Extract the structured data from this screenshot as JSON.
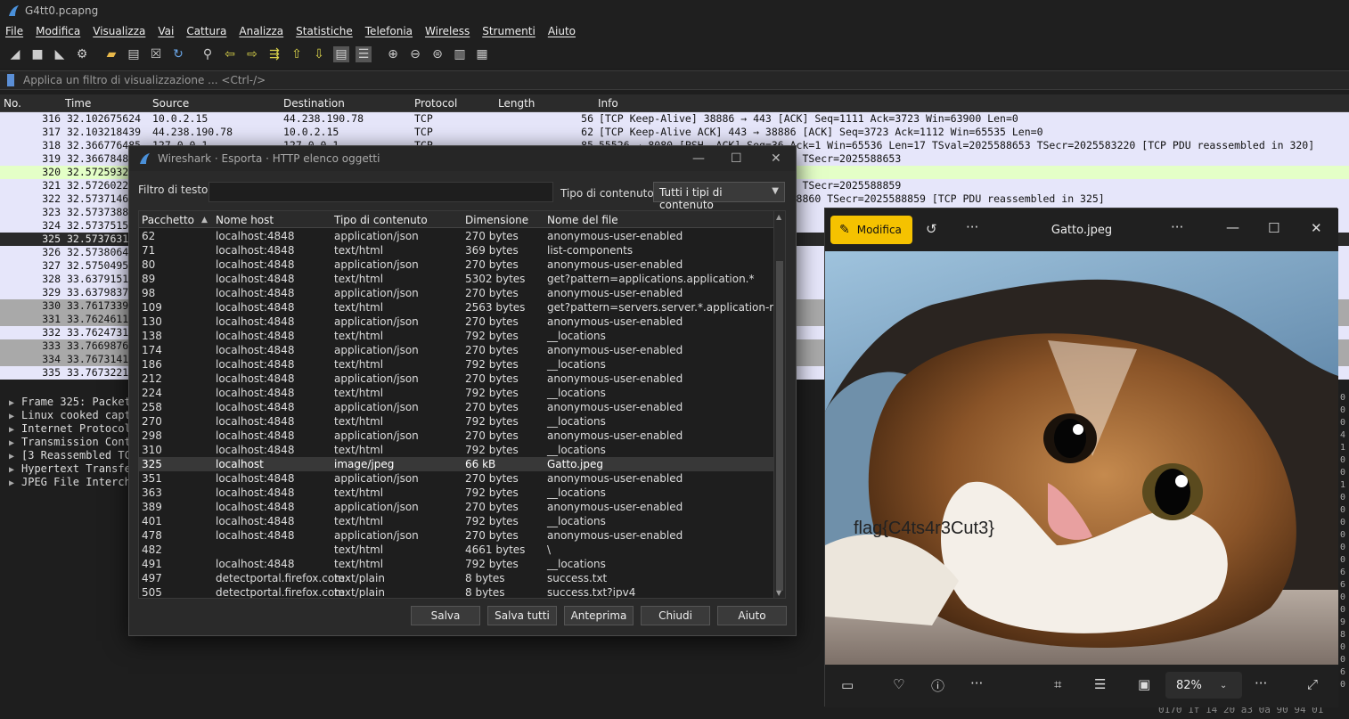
{
  "window": {
    "title": "G4tt0.pcapng"
  },
  "menu": [
    "File",
    "Modifica",
    "Visualizza",
    "Vai",
    "Cattura",
    "Analizza",
    "Statistiche",
    "Telefonia",
    "Wireless",
    "Strumenti",
    "Aiuto"
  ],
  "toolbar_icons": [
    "shark-fin-start-icon",
    "stop-icon",
    "restart-icon",
    "options-gear-icon",
    "open-folder-icon",
    "open-file-icon",
    "close-file-icon",
    "reload-icon",
    "find-icon",
    "back-arrow-icon",
    "forward-arrow-icon",
    "goto-packet-icon",
    "first-packet-icon",
    "last-packet-icon",
    "autoscroll-icon",
    "colorize-icon",
    "zoom-in-icon",
    "zoom-out-icon",
    "zoom-normal-icon",
    "resize-columns-icon",
    "layout-icon"
  ],
  "filter": {
    "placeholder": "Applica un filtro di visualizzazione ... <Ctrl-/>"
  },
  "packet_list": {
    "columns": [
      "No.",
      "Time",
      "Source",
      "Destination",
      "Protocol",
      "Length",
      "Info"
    ],
    "rows": [
      {
        "no": "316",
        "time": "32.102675624",
        "src": "10.0.2.15",
        "dst": "44.238.190.78",
        "proto": "TCP",
        "len": "56",
        "info": "[TCP Keep-Alive] 38886 → 443 [ACK] Seq=1111 Ack=3723 Win=63900 Len=0",
        "style": ""
      },
      {
        "no": "317",
        "time": "32.103218439",
        "src": "44.238.190.78",
        "dst": "10.0.2.15",
        "proto": "TCP",
        "len": "62",
        "info": "[TCP Keep-Alive ACK] 443 → 38886 [ACK] Seq=3723 Ack=1112 Win=65535 Len=0",
        "style": ""
      },
      {
        "no": "318",
        "time": "32.366776485",
        "src": "127.0.0.1",
        "dst": "127.0.0.1",
        "proto": "TCP",
        "len": "85",
        "info": "55526 → 8080 [PSH, ACK] Seq=36 Ack=1 Win=65536 Len=17 TSval=2025588653 TSecr=2025583220 [TCP PDU reassembled in 320]",
        "style": ""
      },
      {
        "no": "319",
        "time": "32.3667848",
        "src": "",
        "dst": "",
        "proto": "",
        "len": "",
        "info": "Win=65536 Len=0 TSval=2025588653 TSecr=2025588653",
        "style": ""
      },
      {
        "no": "320",
        "time": "32.5725932",
        "src": "",
        "dst": "",
        "proto": "",
        "len": "",
        "info": "1",
        "style": "green"
      },
      {
        "no": "321",
        "time": "32.5726022",
        "src": "",
        "dst": "",
        "proto": "",
        "len": "",
        "info": "Win=65536 Len=0 TSval=2025588859 TSecr=2025588859",
        "style": ""
      },
      {
        "no": "322",
        "time": "32.5737146",
        "src": "",
        "dst": "",
        "proto": "",
        "len": "",
        "info": "Win=65536 Len=32768 TSval=2025588860 TSecr=2025588859 [TCP PDU reassembled in 325]",
        "style": ""
      },
      {
        "no": "323",
        "time": "32.5737388",
        "src": "",
        "dst": "",
        "proto": "",
        "len": "",
        "info": "769",
        "style": ""
      },
      {
        "no": "324",
        "time": "32.5737515",
        "src": "",
        "dst": "",
        "proto": "",
        "len": "",
        "info": "",
        "style": ""
      },
      {
        "no": "325",
        "time": "32.5737631",
        "src": "",
        "dst": "",
        "proto": "",
        "len": "",
        "info": "e)",
        "style": "sel"
      },
      {
        "no": "326",
        "time": "32.5738064",
        "src": "",
        "dst": "",
        "proto": "",
        "len": "",
        "info": "514",
        "style": ""
      },
      {
        "no": "327",
        "time": "32.5750495",
        "src": "",
        "dst": "",
        "proto": "",
        "len": "",
        "info": "AC",
        "style": ""
      },
      {
        "no": "328",
        "time": "33.6379151",
        "src": "",
        "dst": "",
        "proto": "",
        "len": "",
        "info": "ACK]",
        "style": ""
      },
      {
        "no": "329",
        "time": "33.6379837",
        "src": "",
        "dst": "",
        "proto": "",
        "len": "",
        "info": "2 [A",
        "style": ""
      },
      {
        "no": "330",
        "time": "33.7617339",
        "src": "",
        "dst": "",
        "proto": "",
        "len": "",
        "info": "Ack=",
        "style": "grey"
      },
      {
        "no": "331",
        "time": "33.7624611",
        "src": "",
        "dst": "",
        "proto": "",
        "len": "",
        "info": "Ack=",
        "style": "grey"
      },
      {
        "no": "332",
        "time": "33.7624731",
        "src": "",
        "dst": "",
        "proto": "",
        "len": "",
        "info": "22 W",
        "style": ""
      },
      {
        "no": "333",
        "time": "33.7669876",
        "src": "",
        "dst": "",
        "proto": "",
        "len": "",
        "info": "Ack=",
        "style": "grey"
      },
      {
        "no": "334",
        "time": "33.7673141",
        "src": "",
        "dst": "",
        "proto": "",
        "len": "",
        "info": "Ack",
        "style": "grey"
      },
      {
        "no": "335",
        "time": "33.7673221",
        "src": "",
        "dst": "",
        "proto": "",
        "len": "",
        "info": "042",
        "style": ""
      }
    ]
  },
  "details": [
    "Frame 325: Packet",
    "Linux cooked capt",
    "Internet Protocol",
    "Transmission Cont",
    "[3 Reassembled TC",
    "Hypertext Transfe",
    "JPEG File Interch"
  ],
  "dialog": {
    "title": "Wireshark · Esporta · HTTP elenco oggetti",
    "filter_label": "Filtro di testo:",
    "ctype_label": "Tipo di contenuto:",
    "ctype_value": "Tutti i tipi di contenuto",
    "columns": [
      "Pacchetto",
      "Nome host",
      "Tipo di contenuto",
      "Dimensione",
      "Nome del file"
    ],
    "rows": [
      [
        "62",
        "localhost:4848",
        "application/json",
        "270 bytes",
        "anonymous-user-enabled"
      ],
      [
        "71",
        "localhost:4848",
        "text/html",
        "369 bytes",
        "list-components"
      ],
      [
        "80",
        "localhost:4848",
        "application/json",
        "270 bytes",
        "anonymous-user-enabled"
      ],
      [
        "89",
        "localhost:4848",
        "text/html",
        "5302 bytes",
        "get?pattern=applications.application.*"
      ],
      [
        "98",
        "localhost:4848",
        "application/json",
        "270 bytes",
        "anonymous-user-enabled"
      ],
      [
        "109",
        "localhost:4848",
        "text/html",
        "2563 bytes",
        "get?pattern=servers.server.*.application-ref.*"
      ],
      [
        "130",
        "localhost:4848",
        "application/json",
        "270 bytes",
        "anonymous-user-enabled"
      ],
      [
        "138",
        "localhost:4848",
        "text/html",
        "792 bytes",
        "__locations"
      ],
      [
        "174",
        "localhost:4848",
        "application/json",
        "270 bytes",
        "anonymous-user-enabled"
      ],
      [
        "186",
        "localhost:4848",
        "text/html",
        "792 bytes",
        "__locations"
      ],
      [
        "212",
        "localhost:4848",
        "application/json",
        "270 bytes",
        "anonymous-user-enabled"
      ],
      [
        "224",
        "localhost:4848",
        "text/html",
        "792 bytes",
        "__locations"
      ],
      [
        "258",
        "localhost:4848",
        "application/json",
        "270 bytes",
        "anonymous-user-enabled"
      ],
      [
        "270",
        "localhost:4848",
        "text/html",
        "792 bytes",
        "__locations"
      ],
      [
        "298",
        "localhost:4848",
        "application/json",
        "270 bytes",
        "anonymous-user-enabled"
      ],
      [
        "310",
        "localhost:4848",
        "text/html",
        "792 bytes",
        "__locations"
      ],
      [
        "325",
        "localhost",
        "image/jpeg",
        "66 kB",
        "Gatto.jpeg"
      ],
      [
        "351",
        "localhost:4848",
        "application/json",
        "270 bytes",
        "anonymous-user-enabled"
      ],
      [
        "363",
        "localhost:4848",
        "text/html",
        "792 bytes",
        "__locations"
      ],
      [
        "389",
        "localhost:4848",
        "application/json",
        "270 bytes",
        "anonymous-user-enabled"
      ],
      [
        "401",
        "localhost:4848",
        "text/html",
        "792 bytes",
        "__locations"
      ],
      [
        "478",
        "localhost:4848",
        "application/json",
        "270 bytes",
        "anonymous-user-enabled"
      ],
      [
        "482",
        "",
        "text/html",
        "4661 bytes",
        "\\"
      ],
      [
        "491",
        "localhost:4848",
        "text/html",
        "792 bytes",
        "__locations"
      ],
      [
        "497",
        "detectportal.firefox.com",
        "text/plain",
        "8 bytes",
        "success.txt"
      ],
      [
        "505",
        "detectportal.firefox.com",
        "text/plain",
        "8 bytes",
        "success.txt?ipv4"
      ]
    ],
    "selected_row": 16,
    "buttons": [
      "Salva",
      "Salva tutti",
      "Anteprima",
      "Chiudi",
      "Aiuto"
    ]
  },
  "viewer": {
    "edit_label": "Modifica",
    "title": "Gatto.jpeg",
    "flag_text": "flag{C4ts4r3Cut3}",
    "zoom": "82%"
  },
  "hex_right": [
    "0",
    "0",
    "0",
    "4",
    "1",
    "0",
    "0",
    "1",
    "0",
    "0",
    "0",
    "0",
    "0",
    "0",
    "6",
    "6",
    "0",
    "0",
    "9",
    "8",
    "0",
    "0",
    "6",
    "0"
  ],
  "hex_bottom": "0170  1f 14 20 a3 0a 90 94 01"
}
